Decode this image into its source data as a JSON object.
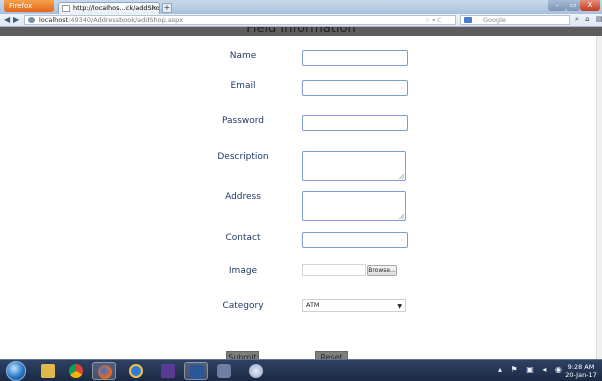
{
  "browser": {
    "app_button": "Firefox",
    "tab_title": "http://localhos...ck/addShop.aspx",
    "new_tab": "+",
    "url_host": "localhost",
    "url_rest": ":49340/Addressbook/addShop.aspx",
    "url_tools": "☆ ▾ C",
    "search_placeholder": "Google",
    "window_min": "–",
    "window_max": "▭",
    "window_close": "X"
  },
  "page": {
    "title": "Field Information"
  },
  "form": {
    "name_label": "Name",
    "email_label": "Email",
    "password_label": "Password",
    "description_label": "Description",
    "address_label": "Address",
    "contact_label": "Contact",
    "image_label": "Image",
    "browse_label": "Browse...",
    "category_label": "Category",
    "category_selected": "ATM",
    "submit_label": "Submit",
    "reset_label": "Reset"
  },
  "taskbar": {
    "apps": [
      "windows-explorer-icon",
      "chrome-icon",
      "firefox-icon",
      "ie-icon",
      "visual-studio-icon",
      "word-icon",
      "media-icon",
      "photos-icon"
    ],
    "time": "9:28 AM",
    "date": "20-Jan-17"
  },
  "colors": {
    "label_text": "#1f3a68",
    "input_border": "#7f9bd4",
    "header_strip": "#5d5d5d",
    "taskbar": "#1b2a44"
  }
}
